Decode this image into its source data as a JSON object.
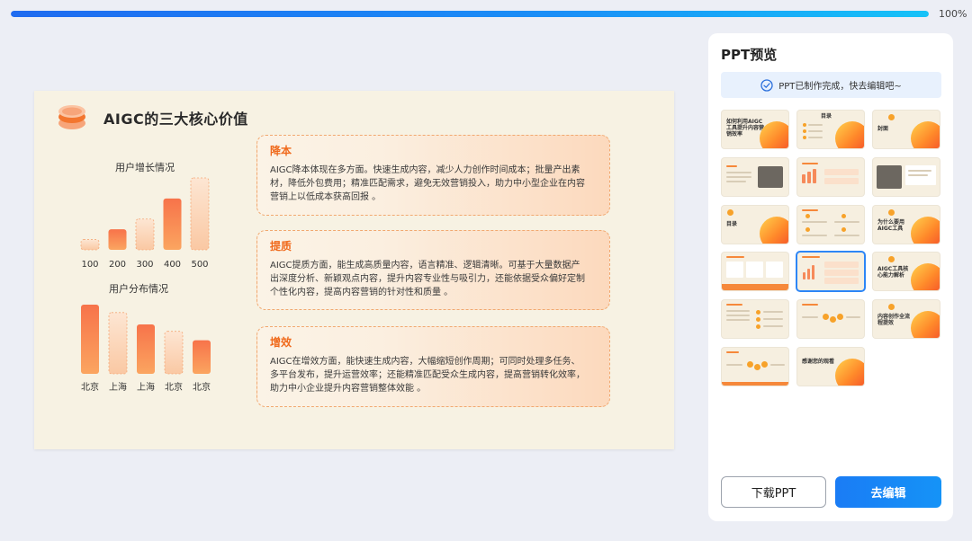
{
  "progress": {
    "value": 1.0,
    "label": "100%"
  },
  "slide": {
    "title": "AIGC的三大核心价值",
    "chart1": {
      "title": "用户增长情况",
      "categories": [
        "100",
        "200",
        "300",
        "400",
        "500"
      ]
    },
    "chart2": {
      "title": "用户分布情况",
      "categories": [
        "北京",
        "上海",
        "上海",
        "北京",
        "北京"
      ]
    },
    "cards": [
      {
        "heading": "降本",
        "text": "AIGC降本体现在多方面。快速生成内容，减少人力创作时间成本；批量产出素材，降低外包费用；精准匹配需求，避免无效营销投入，助力中小型企业在内容营销上以低成本获高回报 。"
      },
      {
        "heading": "提质",
        "text": "AIGC提质方面，能生成高质量内容，语言精准、逻辑清晰。可基于大量数据产出深度分析、新颖观点内容，提升内容专业性与吸引力，还能依据受众偏好定制个性化内容，提高内容营销的针对性和质量 。"
      },
      {
        "heading": "增效",
        "text": "AIGC在增效方面，能快速生成内容，大幅缩短创作周期；可同时处理多任务、多平台发布，提升运营效率；还能精准匹配受众生成内容，提高营销转化效率，助力中小企业提升内容营销整体效能 。"
      }
    ]
  },
  "chart_data": [
    {
      "type": "bar",
      "title": "用户增长情况",
      "categories": [
        "100",
        "200",
        "300",
        "400",
        "500"
      ],
      "values": [
        1,
        2,
        3,
        5,
        7
      ],
      "ylim": [
        0,
        7
      ],
      "grid": false
    },
    {
      "type": "bar",
      "title": "用户分布情况",
      "categories": [
        "北京",
        "上海",
        "上海",
        "北京",
        "北京"
      ],
      "values": [
        7,
        6.2,
        5,
        4.3,
        3.4
      ],
      "ylim": [
        0,
        7
      ],
      "grid": false
    }
  ],
  "panel": {
    "title": "PPT预览",
    "banner": "PPT已制作完成，快去编辑吧~",
    "thumbnails": [
      {
        "label": "如何利用AIGC工具提升内容营销效率"
      },
      {
        "label": "目录"
      },
      {
        "label": "封面"
      },
      {
        "label": ""
      },
      {
        "label": ""
      },
      {
        "label": ""
      },
      {
        "label": "目录"
      },
      {
        "label": ""
      },
      {
        "label": "为什么要用AIGC工具"
      },
      {
        "label": ""
      },
      {
        "label": ""
      },
      {
        "label": "AIGC工具核心能力解析"
      },
      {
        "label": ""
      },
      {
        "label": ""
      },
      {
        "label": "内容创作全流程提效"
      },
      {
        "label": ""
      },
      {
        "label": "感谢您的观看"
      }
    ],
    "download_label": "下载PPT",
    "edit_label": "去编辑"
  },
  "colors": {
    "accent": "#1a7cf5",
    "orange": "#f06a1c",
    "slide_bg": "#f7f2e3"
  },
  "icons": {
    "check": "check-circle-icon",
    "logo": "stacked-disc-logo-icon"
  }
}
